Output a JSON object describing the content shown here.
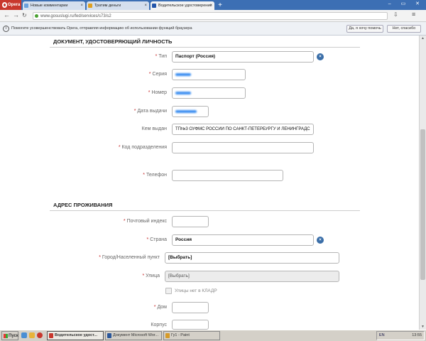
{
  "browser": {
    "opera_label": "Opera",
    "tabs": [
      {
        "label": "Новые комментарии",
        "fav_color": "#6aa0dd"
      },
      {
        "label": "Тратим деньги",
        "fav_color": "#e0a020"
      },
      {
        "label": "Водительское удостоверение",
        "fav_color": "#2255aa"
      }
    ],
    "new_tab": "+",
    "url": "www.gosuslugi.ru/fed/services/s73/s2",
    "window_controls": "–  ▭  ✕"
  },
  "infobar": {
    "icon": "i",
    "text": "Помогите усовершенствовать Opera, отправляя информацию об использовании функций браузера",
    "yes_label": "Да, я хочу помочь",
    "no_label": "Нет, спасибо"
  },
  "document_section": {
    "title": "ДОКУМЕНТ, УДОСТОВЕРЯЮЩИЙ ЛИЧНОСТЬ",
    "type_label": "Тип",
    "type_value": "Паспорт (Россия)",
    "series_label": "Серия",
    "number_label": "Номер",
    "issue_date_label": "Дата выдачи",
    "issued_by_label": "Кем выдан",
    "issued_by_value": "ТП№3 ОУФМС РОССИИ ПО САНКТ-ПЕТЕРБУРГУ И ЛЕНИНГРАДС",
    "division_code_label": "Код подразделения",
    "phone_label": "Телефон"
  },
  "address_section": {
    "title": "АДРЕС ПРОЖИВАНИЯ",
    "postal_code_label": "Почтовый индекс",
    "country_label": "Страна",
    "country_value": "Россия",
    "city_label": "Город/Населенный пункт",
    "city_value": "[Выбрать]",
    "street_label": "Улица",
    "street_value": "[Выбрать]",
    "no_street_label": "Улицы нет в КЛАДР",
    "house_label": "Дом",
    "building_label": "Корпус"
  },
  "taskbar": {
    "start_label": "Пуск",
    "items": [
      {
        "label": "Водительское удост...",
        "icon_color": "#c8372d"
      },
      {
        "label": "Документ Microsoft Wor...",
        "icon_color": "#2b579a"
      },
      {
        "label": "Гу1 - Paint",
        "icon_color": "#d69b2a"
      }
    ],
    "lang": "EN",
    "time": "13:55"
  }
}
